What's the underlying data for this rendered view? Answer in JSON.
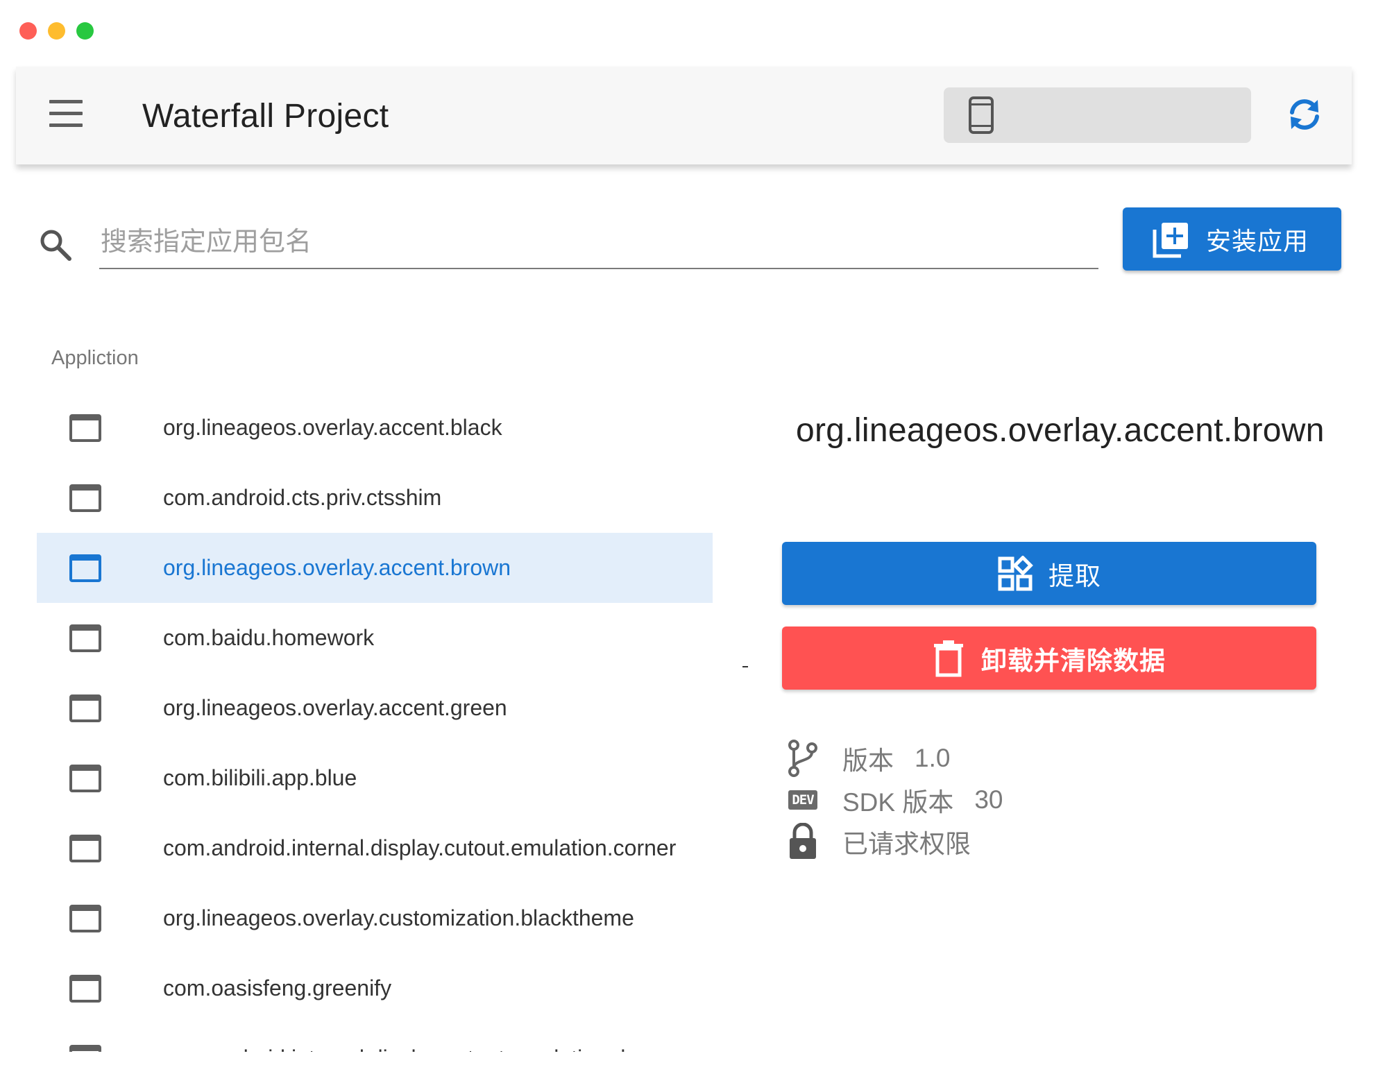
{
  "window": {
    "controls": [
      "close",
      "minimize",
      "maximize"
    ]
  },
  "appbar": {
    "menu_icon": "menu-icon",
    "title": "Waterfall Project",
    "device_selected": "",
    "device_icon": "phone-icon",
    "refresh_icon": "refresh-icon"
  },
  "search": {
    "placeholder": "搜索指定应用包名",
    "value": "",
    "install_label": "安装应用"
  },
  "list": {
    "section_label": "Appliction",
    "items": [
      {
        "label": "org.lineageos.overlay.accent.black"
      },
      {
        "label": "com.android.cts.priv.ctsshim"
      },
      {
        "label": "org.lineageos.overlay.accent.brown"
      },
      {
        "label": "com.baidu.homework"
      },
      {
        "label": "org.lineageos.overlay.accent.green"
      },
      {
        "label": "com.bilibili.app.blue"
      },
      {
        "label": "com.android.internal.display.cutout.emulation.corner"
      },
      {
        "label": "org.lineageos.overlay.customization.blacktheme"
      },
      {
        "label": "com.oasisfeng.greenify"
      },
      {
        "label": "com.android.internal.display.cutout.emulation.double"
      }
    ],
    "selected_index": 2
  },
  "detail": {
    "title": "org.lineageos.overlay.accent.brown",
    "extract_label": "提取",
    "uninstall_label": "卸载并清除数据",
    "version_label": "版本",
    "version_value": "1.0",
    "sdk_label": "SDK 版本",
    "sdk_value": "30",
    "sdk_badge": "DEV",
    "permissions_label": "已请求权限"
  },
  "colors": {
    "primary": "#1976d2",
    "danger": "#ff5252",
    "selected_row": "#e3eefa",
    "appbar": "#f7f7f7"
  }
}
